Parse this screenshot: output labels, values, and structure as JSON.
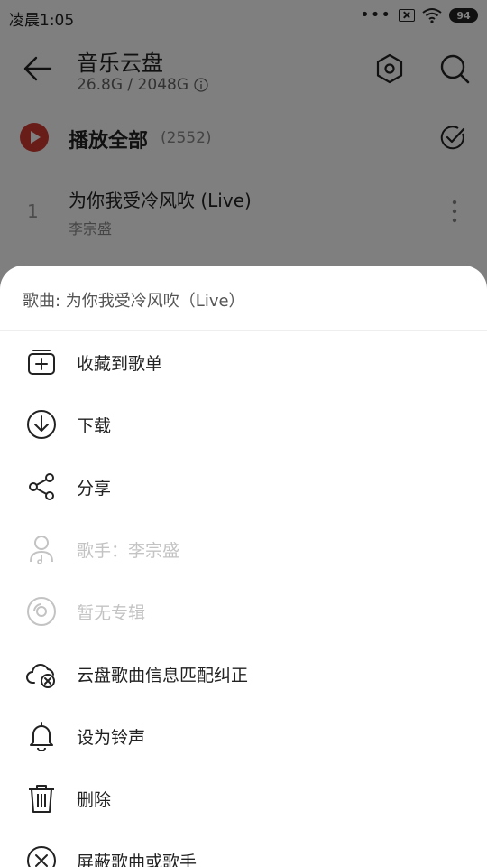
{
  "status_bar": {
    "time": "凌晨1:05",
    "dots": "•••",
    "battery": "94"
  },
  "header": {
    "title": "音乐云盘",
    "storage": "26.8G / 2048G"
  },
  "play_all": {
    "label": "播放全部",
    "count": "(2552)"
  },
  "song": {
    "index": "1",
    "title": "为你我受冷风吹 (Live)",
    "artist": "李宗盛"
  },
  "sheet": {
    "title": "歌曲: 为你我受冷风吹（Live）",
    "items": [
      {
        "label": "收藏到歌单",
        "icon": "add-to-playlist-icon",
        "enabled": true
      },
      {
        "label": "下载",
        "icon": "download-icon",
        "enabled": true
      },
      {
        "label": "分享",
        "icon": "share-icon",
        "enabled": true
      },
      {
        "label": "歌手：李宗盛",
        "icon": "artist-icon",
        "enabled": false
      },
      {
        "label": "暂无专辑",
        "icon": "album-icon",
        "enabled": false
      },
      {
        "label": "云盘歌曲信息匹配纠正",
        "icon": "cloud-fix-icon",
        "enabled": true
      },
      {
        "label": "设为铃声",
        "icon": "bell-icon",
        "enabled": true
      },
      {
        "label": "删除",
        "icon": "trash-icon",
        "enabled": true
      },
      {
        "label": "屏蔽歌曲或歌手",
        "icon": "block-icon",
        "enabled": true
      }
    ]
  },
  "colors": {
    "accent": "#d33a31",
    "overlay": "rgba(0,0,0,0.5)",
    "disabled": "#c3c3c3"
  }
}
